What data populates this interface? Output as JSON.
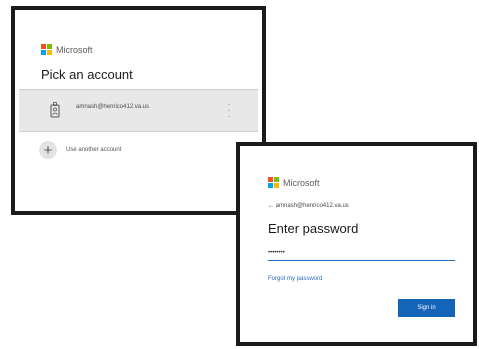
{
  "pick_account_dialog": {
    "brand": "Microsoft",
    "title": "Pick an account",
    "account_email": "amnash@henrico412.va.us",
    "another_account_label": "Use another account"
  },
  "password_dialog": {
    "brand": "Microsoft",
    "back_email": "amnash@henrico412.va.us",
    "title": "Enter password",
    "password_value": "••••••••",
    "forgot_link": "Forgot my password",
    "signin_label": "Sign in"
  },
  "colors": {
    "ms_red": "#f25022",
    "ms_green": "#7fba00",
    "ms_blue": "#00a4ef",
    "ms_yellow": "#ffb900",
    "accent_blue": "#1464b8",
    "selected_row": "#e8e8e8"
  },
  "icons": [
    "person-badge-icon",
    "more-options-icon",
    "plus-icon",
    "back-arrow-icon"
  ]
}
